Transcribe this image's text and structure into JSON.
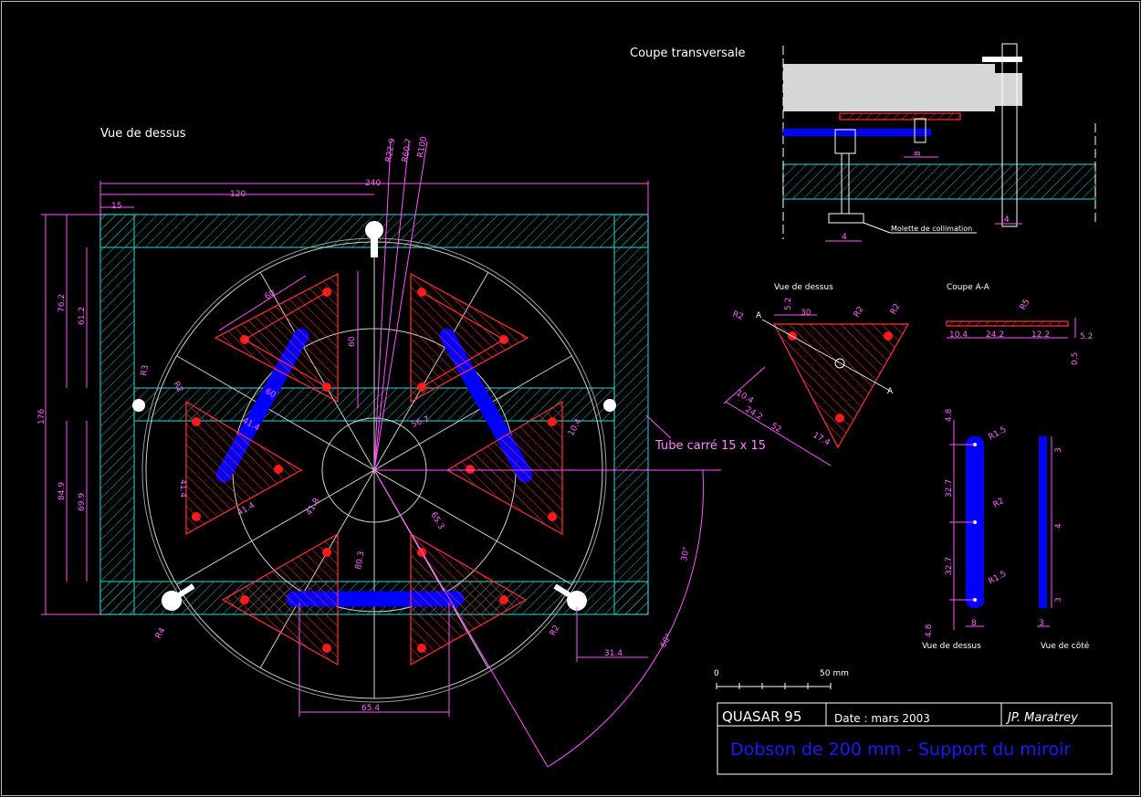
{
  "views": {
    "top_view_title": "Vue de dessus",
    "cross_section_title": "Coupe transversale",
    "pad_top_view_title": "Vue de dessus",
    "pad_section_title": "Coupe A-A",
    "bar_top_view_title": "Vue de dessus",
    "bar_side_view_title": "Vue de côté"
  },
  "annotations": {
    "tube_label": "Tube carré 15 x 15",
    "knob_label": "Molette de collimation",
    "section_marker": "A"
  },
  "dimensions": {
    "main": {
      "overall_width": "240",
      "half_width": "120",
      "tube_width": "15",
      "overall_height": "176",
      "upper_outer": "76.2",
      "upper_inner": "61.2",
      "lower_outer": "84.9",
      "lower_inner": "69.9",
      "radius_1": "R22.9",
      "radius_2": "R60.7",
      "radius_3": "R100",
      "triangle_side": "60",
      "triangle_height": "60",
      "triangle_side_2": "60",
      "triangle_inner_1": "41.4",
      "triangle_inner_2": "41.4",
      "triangle_inner_3": "41.4",
      "angle_dim": "56.7",
      "hole_offset": "10.4",
      "pivot_radius": "R3",
      "pad_radius_1": "R2",
      "pad_radius_2": "R2",
      "arc_dim_1": "41.8",
      "arc_dim_2": "80.3",
      "arc_dim_3": "65.3",
      "bottom_width": "65.4",
      "bottom_offset": "31.4",
      "angle_30": "30°",
      "angle_60": "60°",
      "corner_radius": "R4"
    },
    "cross_section": {
      "d1": "4",
      "d2": "4",
      "d3": "8"
    },
    "pad_top": {
      "r_top_left": "R2",
      "r_top_mid": "R2",
      "r_top_right": "R2",
      "top_offset": "5.2",
      "top_width": "30",
      "bottom_a": "10.4",
      "bottom_b": "24.2",
      "bottom_total": "52",
      "bottom_c": "17.4"
    },
    "pad_section": {
      "radius": "R5",
      "a": "10.4",
      "b": "24.2",
      "c": "12.2",
      "thickness": "5.2",
      "step": "0.5"
    },
    "bar_top": {
      "end_top": "4.8",
      "span_1": "32.7",
      "span_2": "32.7",
      "end_bottom": "4.8",
      "radius_top": "R1.5",
      "radius_mid": "R2",
      "radius_bottom": "R1.5",
      "width": "8"
    },
    "bar_side": {
      "top": "3",
      "mid": "4",
      "bottom": "3",
      "width": "3"
    }
  },
  "scale_bar": {
    "start": "0",
    "end": "50 mm"
  },
  "title_block": {
    "project": "QUASAR 95",
    "date": "Date : mars 2003",
    "author": "JP. Maratrey",
    "title": "Dobson de 200 mm - Support du miroir"
  },
  "colors": {
    "background": "#000000",
    "frame": "#29b5b5",
    "dimension": "#ff55ff",
    "pad": "#ff3333",
    "bar": "#0000ff",
    "title_text": "#0000ff"
  }
}
